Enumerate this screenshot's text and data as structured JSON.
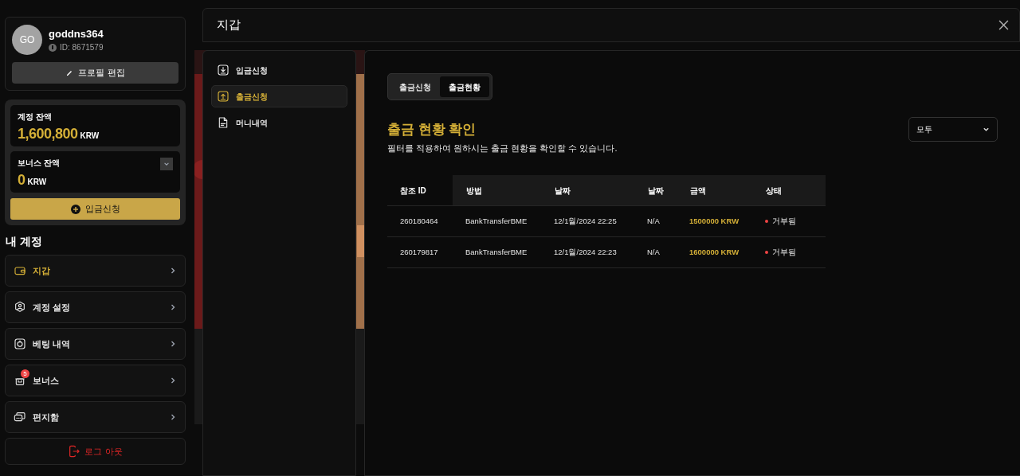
{
  "profile": {
    "avatar": "GO",
    "username": "goddns364",
    "id": "ID: 8671579",
    "edit_button": "프로필 편집"
  },
  "balances": [
    {
      "label": "계정 잔액",
      "amount": "1,600,800",
      "currency": "KRW",
      "expandable": false
    },
    {
      "label": "보너스 잔액",
      "amount": "0",
      "currency": "KRW",
      "expandable": true
    }
  ],
  "deposit_button": "입금신청",
  "account": {
    "title": "내 계정",
    "items": [
      {
        "kind": "wallet",
        "label": "지갑",
        "selected": true
      },
      {
        "kind": "user",
        "label": "계정 설정",
        "selected": false
      },
      {
        "kind": "history",
        "label": "베팅 내역",
        "selected": false
      },
      {
        "kind": "bonus",
        "label": "보너스",
        "selected": false,
        "badge": "5"
      },
      {
        "kind": "mail",
        "label": "편지함",
        "selected": false
      }
    ]
  },
  "logout_button": "로그 아웃",
  "modal": {
    "title": "지갑",
    "nav": [
      {
        "kind": "download",
        "label": "입금신청",
        "selected": false
      },
      {
        "kind": "upload",
        "label": "출금신청",
        "selected": true
      },
      {
        "kind": "doc",
        "label": "머니내역",
        "selected": false
      }
    ],
    "tabs": [
      {
        "label": "출금신청",
        "selected": false
      },
      {
        "label": "출금현황",
        "selected": true
      }
    ],
    "heading": "출금 현황 확인",
    "description": "필터를 적용하여 원하시는 출금 현황을 확인할 수 있습니다.",
    "filter": {
      "value": "모두"
    },
    "table": {
      "columns": [
        "참조 ID",
        "방법",
        "날짜",
        "날짜",
        "금액",
        "상태"
      ],
      "rows": [
        {
          "id": "260180464",
          "method": "BankTransferBME",
          "date": "12/1월/2024 22:25",
          "date_2": "N/A",
          "amount": "1500000 KRW",
          "status": "거부됨",
          "color": "#ef4444"
        },
        {
          "id": "260179817",
          "method": "BankTransferBME",
          "date": "12/1월/2024 22:23",
          "date_2": "N/A",
          "amount": "1600000 KRW",
          "status": "거부됨",
          "color": "#ef4444"
        }
      ]
    }
  }
}
